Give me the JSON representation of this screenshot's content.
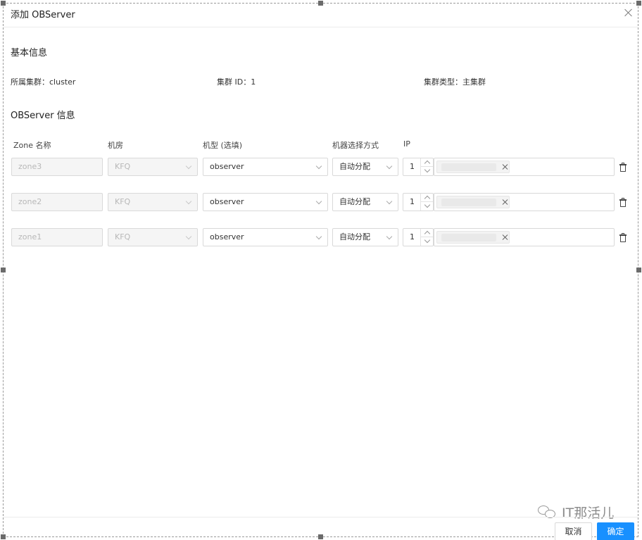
{
  "modal": {
    "title": "添加 OBServer",
    "cancel_label": "取消",
    "ok_label": "确定"
  },
  "basic_info": {
    "section_title": "基本信息",
    "cluster": "所属集群：cluster",
    "cluster_id": "集群 ID：1",
    "cluster_type": "集群类型：主集群"
  },
  "observer_info": {
    "section_title": "OBServer 信息",
    "columns": [
      "Zone 名称",
      "机房",
      "机型 (选填)",
      "机器选择方式",
      "IP"
    ],
    "rows": [
      {
        "zone": "zone3",
        "idc": "KFQ",
        "model": "observer",
        "select_mode": "自动分配",
        "count": "1"
      },
      {
        "zone": "zone2",
        "idc": "KFQ",
        "model": "observer",
        "select_mode": "自动分配",
        "count": "1"
      },
      {
        "zone": "zone1",
        "idc": "KFQ",
        "model": "observer",
        "select_mode": "自动分配",
        "count": "1"
      }
    ]
  },
  "watermark": {
    "text": "IT那活儿"
  },
  "colors": {
    "primary": "#1890ff",
    "border": "#d9d9d9",
    "disabled_bg": "#f5f5f5"
  },
  "icons": [
    "close-icon",
    "chevron-down-icon",
    "stepper-up-icon",
    "stepper-down-icon",
    "remove-tag-icon",
    "trash-icon",
    "wechat-icon"
  ]
}
